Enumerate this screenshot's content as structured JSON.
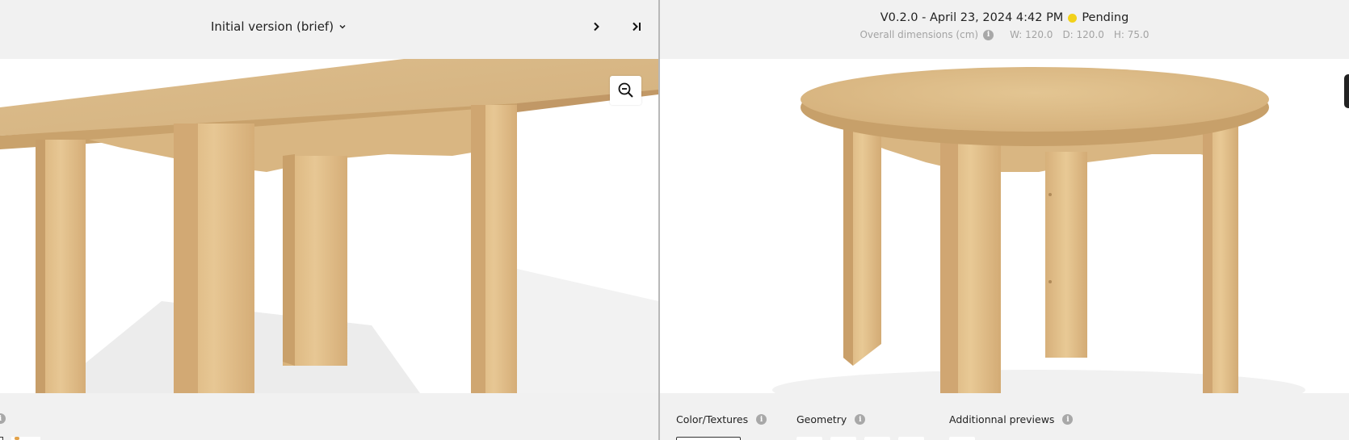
{
  "left": {
    "version_label": "Initial version (brief)",
    "icons": {
      "dropdown": "chevron-down-icon",
      "next": "chevron-right-icon",
      "last": "skip-to-end-icon",
      "zoom": "zoom-out-icon",
      "info": "info-icon"
    }
  },
  "right": {
    "version_line": "V0.2.0 - April 23, 2024 4:42 PM",
    "status": "Pending",
    "status_color": "#f2d11a",
    "dimensions_label": "Overall dimensions (cm)",
    "dim_w": "W: 120.0",
    "dim_d": "D: 120.0",
    "dim_h": "H: 75.0",
    "footer": {
      "color_textures": "Color/Textures",
      "geometry": "Geometry",
      "additional_previews": "Additionnal previews"
    }
  },
  "colors": {
    "wood_light": "#e6c794",
    "wood_mid": "#d8b27c",
    "wood_dark": "#c49a63",
    "background": "#f1f1f1"
  }
}
